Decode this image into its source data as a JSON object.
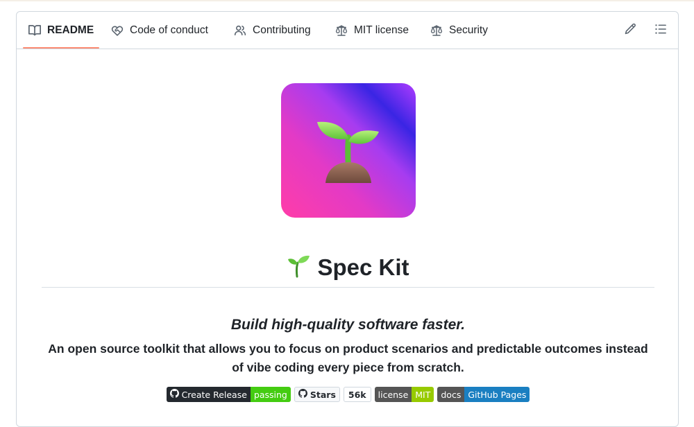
{
  "tabs": [
    {
      "label": "README",
      "icon": "book-icon",
      "active": true
    },
    {
      "label": "Code of conduct",
      "icon": "code-of-conduct-icon",
      "active": false
    },
    {
      "label": "Contributing",
      "icon": "people-icon",
      "active": false
    },
    {
      "label": "MIT license",
      "icon": "law-icon",
      "active": false
    },
    {
      "label": "Security",
      "icon": "law-icon",
      "active": false
    }
  ],
  "toolbar": {
    "edit_icon": "pencil-icon",
    "outline_icon": "list-unordered-icon"
  },
  "readme": {
    "title": "Spec Kit",
    "title_emoji": "seedling",
    "tagline": "Build high-quality software faster.",
    "description": "An open source toolkit that allows you to focus on product scenarios and predictable outcomes instead of vibe coding every piece from scratch."
  },
  "badges": {
    "release": {
      "label": "Create Release",
      "status": "passing"
    },
    "stars": {
      "label": "Stars",
      "count": "56k"
    },
    "license": {
      "label": "license",
      "value": "MIT"
    },
    "docs": {
      "label": "docs",
      "value": "GitHub Pages"
    }
  },
  "colors": {
    "accent_underline": "#fd8c73",
    "border": "#d0d7de",
    "logo_gradient": [
      "#ff3da8",
      "#b03cff",
      "#2a1de0"
    ],
    "badge_green": "#44cc11",
    "badge_lime": "#97ca00",
    "badge_blue": "#1a7fc1"
  }
}
